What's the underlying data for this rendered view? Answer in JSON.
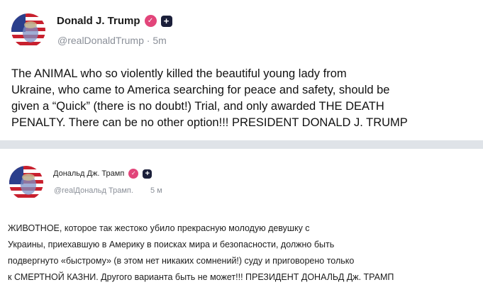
{
  "posts": [
    {
      "display_name": "Donald J. Trump",
      "handle": "@realDonaldTrump",
      "separator": "·",
      "time": "5m",
      "lines": [
        "The ANIMAL who so violently killed the beautiful young lady from",
        "Ukraine, who came to America searching for peace and safety, should be",
        "given a “Quick” (there is no doubt!) Trial, and only awarded THE DEATH",
        "PENALTY. There can be no other option!!! PRESIDENT DONALD J. TRUMP"
      ]
    },
    {
      "display_name": "Дональд Дж. Трамп",
      "handle": "@realДональд Трамп.",
      "time": "5 м",
      "lines": [
        "ЖИВОТНОЕ, которое так жестоко убило прекрасную молодую девушку с",
        "Украины, приехавшую в Америку в поисках мира и безопасности, должно быть",
        "подвергнуто «быстрому» (в этом нет никаких сомнений!) суду и приговорено только",
        "к СМЕРТНОЙ КАЗНИ. Другого варианта быть не может!!! ПРЕЗИДЕНТ ДОНАЛЬД Дж. ТРАМП"
      ]
    }
  ],
  "colors": {
    "badge": "#e2457a",
    "plus_box": "#1b1f3a",
    "handle_text": "#8a8f98",
    "page_background": "#dfe3e8"
  },
  "icons": {
    "badge": "checkmark-badge-icon",
    "plus": "plus-box-icon"
  }
}
